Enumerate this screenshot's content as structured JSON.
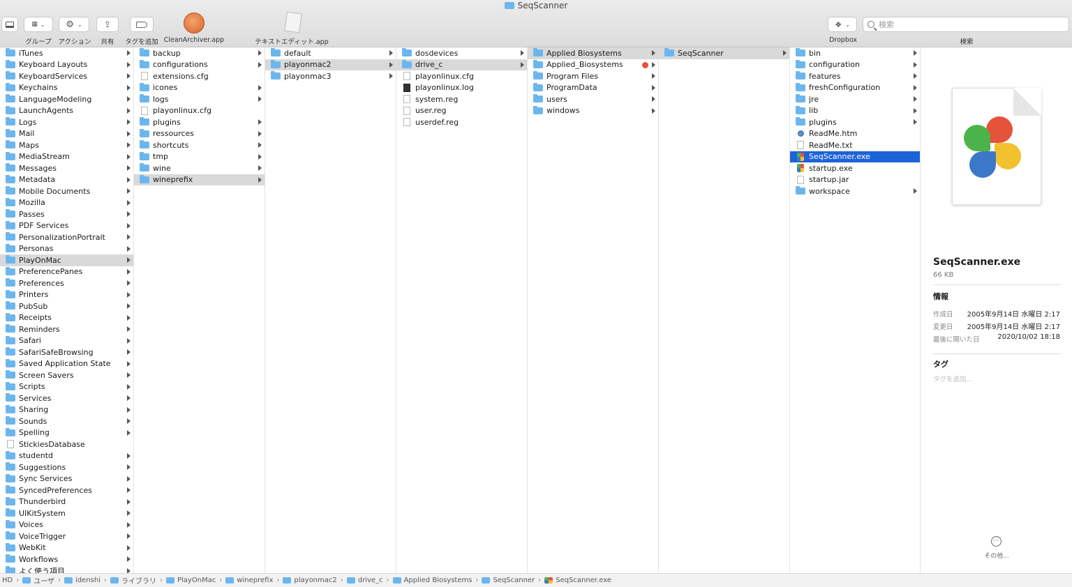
{
  "window": {
    "title": "SeqScanner"
  },
  "toolbar": {
    "group_label": "グループ",
    "action_label": "アクション",
    "share_label": "共有",
    "tag_label": "タグを追加",
    "app1_label": "CleanArchiver.app",
    "app2_label": "テキストエディット.app",
    "dropbox_label": "Dropbox",
    "search_label": "検索",
    "search_placeholder": "検索"
  },
  "columns": [
    {
      "items": [
        {
          "name": "iTunes",
          "kind": "folder",
          "arrow": true
        },
        {
          "name": "Keyboard Layouts",
          "kind": "folder",
          "arrow": true
        },
        {
          "name": "KeyboardServices",
          "kind": "folder",
          "arrow": true
        },
        {
          "name": "Keychains",
          "kind": "folder",
          "arrow": true
        },
        {
          "name": "LanguageModeling",
          "kind": "folder",
          "arrow": true
        },
        {
          "name": "LaunchAgents",
          "kind": "folder",
          "arrow": true
        },
        {
          "name": "Logs",
          "kind": "folder",
          "arrow": true
        },
        {
          "name": "Mail",
          "kind": "folder",
          "arrow": true
        },
        {
          "name": "Maps",
          "kind": "folder",
          "arrow": true
        },
        {
          "name": "MediaStream",
          "kind": "folder",
          "arrow": true
        },
        {
          "name": "Messages",
          "kind": "folder",
          "arrow": true
        },
        {
          "name": "Metadata",
          "kind": "folder",
          "arrow": true
        },
        {
          "name": "Mobile Documents",
          "kind": "folder",
          "arrow": true
        },
        {
          "name": "Mozilla",
          "kind": "folder",
          "arrow": true
        },
        {
          "name": "Passes",
          "kind": "folder",
          "arrow": true
        },
        {
          "name": "PDF Services",
          "kind": "folder",
          "arrow": true
        },
        {
          "name": "PersonalizationPortrait",
          "kind": "folder",
          "arrow": true
        },
        {
          "name": "Personas",
          "kind": "folder",
          "arrow": true
        },
        {
          "name": "PlayOnMac",
          "kind": "folder",
          "arrow": true,
          "selected": true
        },
        {
          "name": "PreferencePanes",
          "kind": "folder",
          "arrow": true
        },
        {
          "name": "Preferences",
          "kind": "folder",
          "arrow": true
        },
        {
          "name": "Printers",
          "kind": "folder",
          "arrow": true
        },
        {
          "name": "PubSub",
          "kind": "folder",
          "arrow": true
        },
        {
          "name": "Receipts",
          "kind": "folder",
          "arrow": true
        },
        {
          "name": "Reminders",
          "kind": "folder",
          "arrow": true
        },
        {
          "name": "Safari",
          "kind": "folder",
          "arrow": true
        },
        {
          "name": "SafariSafeBrowsing",
          "kind": "folder",
          "arrow": true
        },
        {
          "name": "Saved Application State",
          "kind": "folder",
          "arrow": true
        },
        {
          "name": "Screen Savers",
          "kind": "folder",
          "arrow": true
        },
        {
          "name": "Scripts",
          "kind": "folder",
          "arrow": true
        },
        {
          "name": "Services",
          "kind": "folder",
          "arrow": true
        },
        {
          "name": "Sharing",
          "kind": "folder",
          "arrow": true
        },
        {
          "name": "Sounds",
          "kind": "folder",
          "arrow": true
        },
        {
          "name": "Spelling",
          "kind": "folder",
          "arrow": true
        },
        {
          "name": "StickiesDatabase",
          "kind": "doc",
          "arrow": false
        },
        {
          "name": "studentd",
          "kind": "folder",
          "arrow": true
        },
        {
          "name": "Suggestions",
          "kind": "folder",
          "arrow": true
        },
        {
          "name": "Sync Services",
          "kind": "folder",
          "arrow": true
        },
        {
          "name": "SyncedPreferences",
          "kind": "folder",
          "arrow": true
        },
        {
          "name": "Thunderbird",
          "kind": "folder",
          "arrow": true
        },
        {
          "name": "UIKitSystem",
          "kind": "folder",
          "arrow": true
        },
        {
          "name": "Voices",
          "kind": "folder",
          "arrow": true
        },
        {
          "name": "VoiceTrigger",
          "kind": "folder",
          "arrow": true
        },
        {
          "name": "WebKit",
          "kind": "folder",
          "arrow": true
        },
        {
          "name": "Workflows",
          "kind": "folder",
          "arrow": true
        },
        {
          "name": "よく使う項目",
          "kind": "folder",
          "arrow": true
        }
      ]
    },
    {
      "items": [
        {
          "name": "backup",
          "kind": "folder",
          "arrow": true
        },
        {
          "name": "configurations",
          "kind": "folder",
          "arrow": true
        },
        {
          "name": "extensions.cfg",
          "kind": "doc",
          "arrow": false
        },
        {
          "name": "icones",
          "kind": "folder",
          "arrow": true
        },
        {
          "name": "logs",
          "kind": "folder",
          "arrow": true
        },
        {
          "name": "playonlinux.cfg",
          "kind": "doc",
          "arrow": false
        },
        {
          "name": "plugins",
          "kind": "folder",
          "arrow": true
        },
        {
          "name": "ressources",
          "kind": "folder",
          "arrow": true
        },
        {
          "name": "shortcuts",
          "kind": "folder",
          "arrow": true
        },
        {
          "name": "tmp",
          "kind": "folder",
          "arrow": true
        },
        {
          "name": "wine",
          "kind": "folder",
          "arrow": true
        },
        {
          "name": "wineprefix",
          "kind": "folder",
          "arrow": true,
          "selected": true
        }
      ]
    },
    {
      "items": [
        {
          "name": "default",
          "kind": "folder",
          "arrow": true
        },
        {
          "name": "playonmac2",
          "kind": "folder",
          "arrow": true,
          "selected": true
        },
        {
          "name": "playonmac3",
          "kind": "folder",
          "arrow": true
        }
      ]
    },
    {
      "items": [
        {
          "name": "dosdevices",
          "kind": "folder",
          "arrow": true
        },
        {
          "name": "drive_c",
          "kind": "folder",
          "arrow": true,
          "selected": true
        },
        {
          "name": "playonlinux.cfg",
          "kind": "doc",
          "arrow": false
        },
        {
          "name": "playonlinux.log",
          "kind": "doc-dark",
          "arrow": false
        },
        {
          "name": "system.reg",
          "kind": "doc",
          "arrow": false
        },
        {
          "name": "user.reg",
          "kind": "doc",
          "arrow": false
        },
        {
          "name": "userdef.reg",
          "kind": "doc",
          "arrow": false
        }
      ]
    },
    {
      "items": [
        {
          "name": "Applied Biosystems",
          "kind": "folder",
          "arrow": true,
          "selected": true
        },
        {
          "name": "Applied_Biosystems",
          "kind": "folder",
          "arrow": true,
          "tag": "#e5533b"
        },
        {
          "name": "Program Files",
          "kind": "folder",
          "arrow": true
        },
        {
          "name": "ProgramData",
          "kind": "folder",
          "arrow": true
        },
        {
          "name": "users",
          "kind": "folder",
          "arrow": true
        },
        {
          "name": "windows",
          "kind": "folder",
          "arrow": true
        }
      ]
    },
    {
      "items": [
        {
          "name": "SeqScanner",
          "kind": "folder",
          "arrow": true,
          "selected": true
        }
      ]
    },
    {
      "items": [
        {
          "name": "bin",
          "kind": "folder",
          "arrow": true
        },
        {
          "name": "configuration",
          "kind": "folder",
          "arrow": true
        },
        {
          "name": "features",
          "kind": "folder",
          "arrow": true
        },
        {
          "name": "freshConfiguration",
          "kind": "folder",
          "arrow": true
        },
        {
          "name": "jre",
          "kind": "folder",
          "arrow": true
        },
        {
          "name": "lib",
          "kind": "folder",
          "arrow": true
        },
        {
          "name": "plugins",
          "kind": "folder",
          "arrow": true
        },
        {
          "name": "ReadMe.htm",
          "kind": "doc-blue",
          "arrow": false
        },
        {
          "name": "ReadMe.txt",
          "kind": "doc",
          "arrow": false
        },
        {
          "name": "SeqScanner.exe",
          "kind": "doc-clover",
          "arrow": false,
          "highlight": true
        },
        {
          "name": "startup.exe",
          "kind": "doc-clover",
          "arrow": false
        },
        {
          "name": "startup.jar",
          "kind": "doc",
          "arrow": false
        },
        {
          "name": "workspace",
          "kind": "folder",
          "arrow": true
        }
      ]
    }
  ],
  "preview": {
    "name": "SeqScanner.exe",
    "size": "66 KB",
    "info_heading": "情報",
    "created_label": "作成日",
    "created_value": "2005年9月14日 水曜日 2:17",
    "modified_label": "変更日",
    "modified_value": "2005年9月14日 水曜日 2:17",
    "opened_label": "最後に開いた日",
    "opened_value": "2020/10/02 18:18",
    "tags_heading": "タグ",
    "tags_placeholder": "タグを追加...",
    "more_label": "その他..."
  },
  "pathbar": [
    "HD",
    "ユーザ",
    "idenshi",
    "ライブラリ",
    "PlayOnMac",
    "wineprefix",
    "playonmac2",
    "drive_c",
    "Applied Biosystems",
    "SeqScanner",
    "SeqScanner.exe"
  ],
  "colors": {
    "folder": "#6cb6ee",
    "selection": "#1d63d8",
    "tag_red": "#e5533b"
  }
}
